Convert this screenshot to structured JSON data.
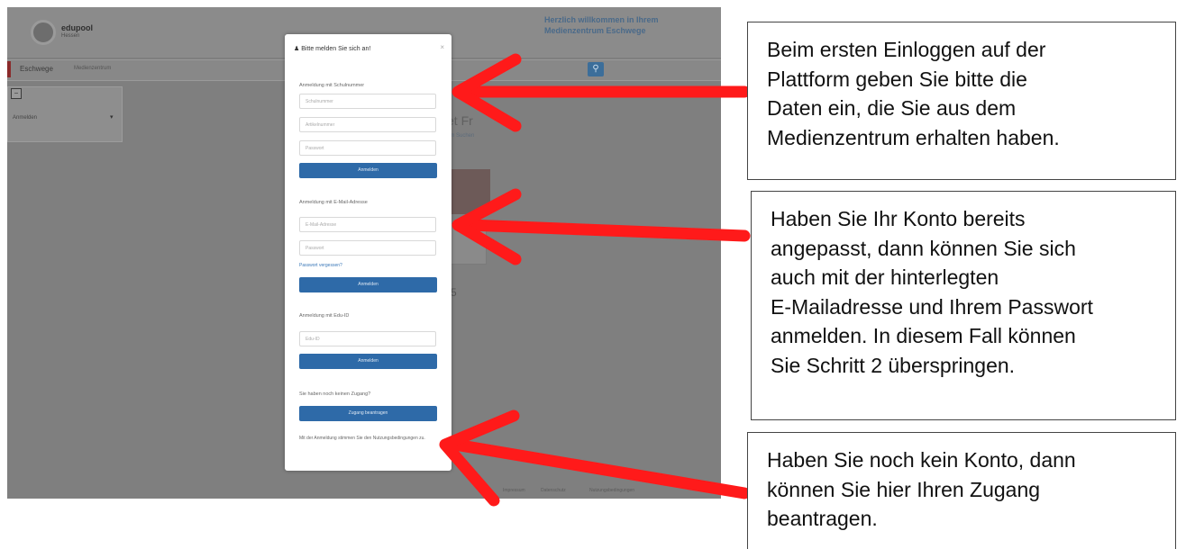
{
  "screenshot": {
    "brand": "edupool",
    "brand_sub": "Hessen",
    "welcome": "Herzlich willkommen in Ihrem Medienzentrum Eschwege",
    "nav_region": "Eschwege",
    "nav_crumb": "Medienzentrum",
    "search_icon": "search-icon",
    "sidebar_item": "Anmelden",
    "content_title": "et Fr",
    "content_sub": "um Suchen",
    "content_num": "5",
    "footer_links": [
      "Impressum",
      "Datenschutz",
      "Nutzungsbedingungen"
    ]
  },
  "modal": {
    "title": "Bitte melden Sie sich an!",
    "close": "×",
    "section1_label": "Anmeldung mit Schulnummer",
    "school_number_placeholder": "Schulnummer",
    "article_number_placeholder": "Artikelnummer",
    "password_placeholder_1": "Passwort",
    "login_button_1": "Anmelden",
    "section2_label": "Anmeldung mit E-Mail-Adresse",
    "email_placeholder": "E-Mail-Adresse",
    "password_placeholder_2": "Passwort",
    "forgot_password": "Passwort vergessen?",
    "login_button_2": "Anmelden",
    "section3_label": "Anmeldung mit Edu-ID",
    "eduid_placeholder": "Edu-ID",
    "login_button_3": "Anmelden",
    "no_access_label": "Sie haben noch keinen Zugang?",
    "request_access_button": "Zugang beantragen",
    "terms_text": "Mit der Anmeldung stimmen Sie den Nutzungsbedingungen zu."
  },
  "callouts": {
    "first": "Beim ersten Einloggen auf der\nPlattform geben Sie bitte die\nDaten ein, die Sie aus dem\nMedienzentrum erhalten haben.",
    "second": "Haben Sie Ihr Konto bereits\nangepasst, dann können Sie sich\nauch mit der hinterlegten\nE-Mailadresse und Ihrem Passwort\nanmelden. In diesem Fall können\nSie Schritt 2 überspringen.",
    "third": "Haben Sie noch kein Konto, dann\nkönnen Sie hier Ihren Zugang\nbeantragen."
  },
  "colors": {
    "arrow": "#ff1a1a",
    "overlay": "#7f7f7f",
    "primary_button": "#2e6aa8",
    "callout_border": "#444444"
  }
}
